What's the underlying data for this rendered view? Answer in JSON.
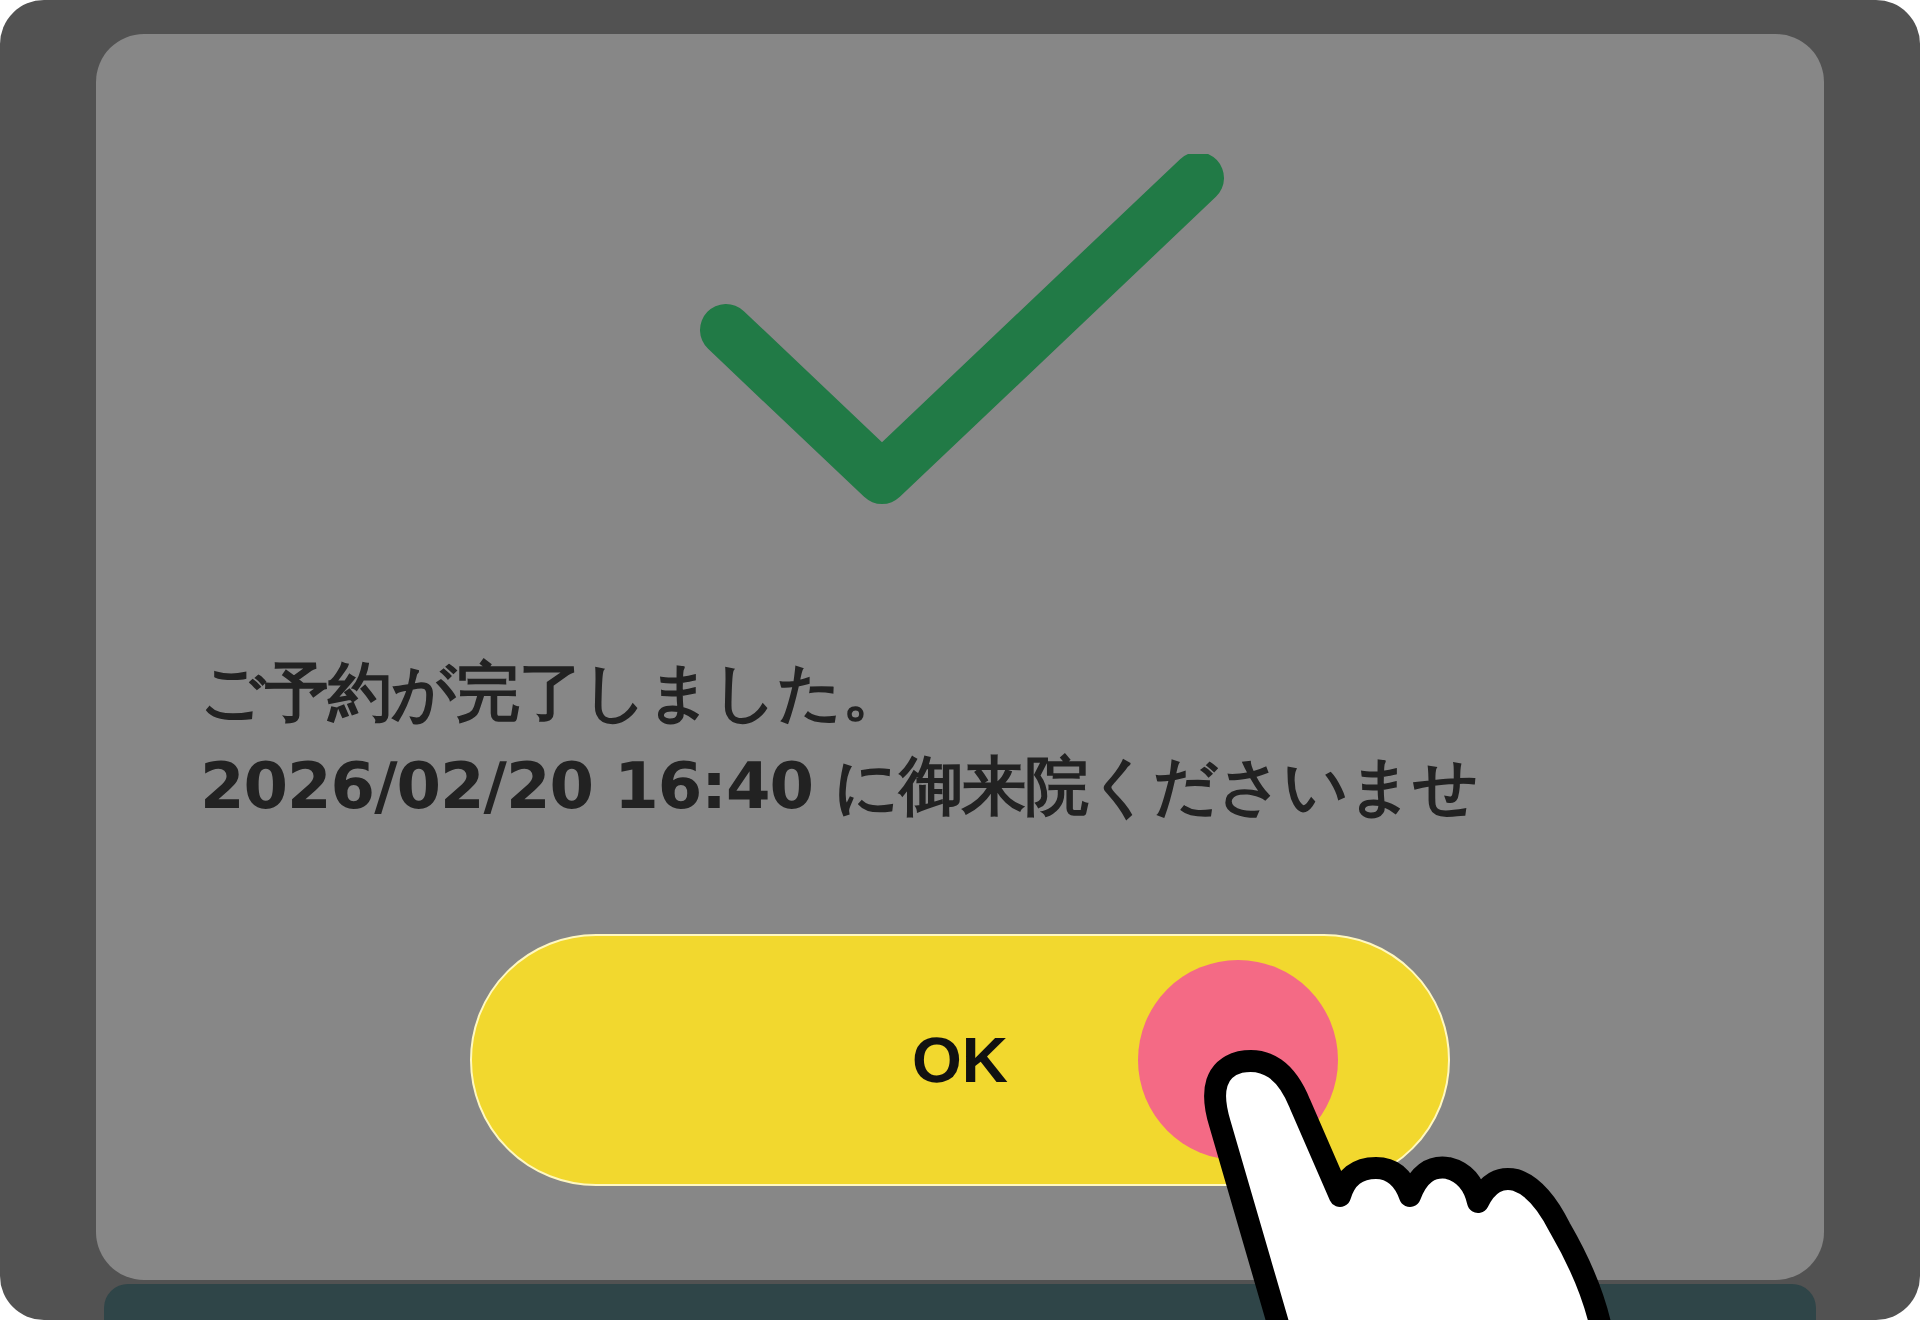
{
  "dialog": {
    "message_lines": [
      "ご予約が完了しました。",
      "2026/02/20 16:40 に御来院くださいませ"
    ],
    "button": {
      "label": "OK"
    }
  }
}
